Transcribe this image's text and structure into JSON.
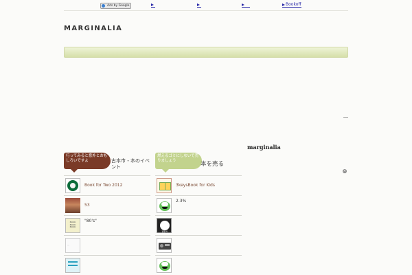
{
  "topbar": {
    "ads_label": "Ads by Google",
    "links": [
      "",
      "",
      "",
      "Bookoff"
    ]
  },
  "site": {
    "title": "MARGINALIA"
  },
  "sidebar_right": {
    "title": "marginalia",
    "close_icon": "close-icon"
  },
  "left_column": {
    "bubble": "行ってみると意外とおもしろいですよ",
    "title": "古本市・本のイベント",
    "items": [
      {
        "label": "Book for Two 2012",
        "thumb_icon": "starbucks-logo-icon"
      },
      {
        "label": "53",
        "thumb_icon": "bookstore-photo-icon"
      },
      {
        "label": "\"80's\"",
        "thumb_icon": "book-cover-icon"
      },
      {
        "label": "",
        "thumb_icon": "blank-thumbnail-icon"
      },
      {
        "label": "",
        "thumb_icon": "blue-cover-icon"
      }
    ]
  },
  "right_column": {
    "bubble": "燃えるゴミにしないで売りましょう",
    "title": "本を売る",
    "items": [
      {
        "label": "3keysBook for Kids",
        "thumb_icon": "notebook-icon"
      },
      {
        "label": "2.3%",
        "thumb_icon": "green-monster-icon"
      },
      {
        "label": "",
        "thumb_icon": "kaitori-badge-icon"
      },
      {
        "label": "",
        "thumb_icon": "radio-device-icon"
      },
      {
        "label": "",
        "thumb_icon": "green-monster-icon"
      }
    ]
  },
  "colors": {
    "accent_brown": "#7a3a27",
    "accent_green": "#c2d38d",
    "bar_green": "#d5dfa9"
  }
}
